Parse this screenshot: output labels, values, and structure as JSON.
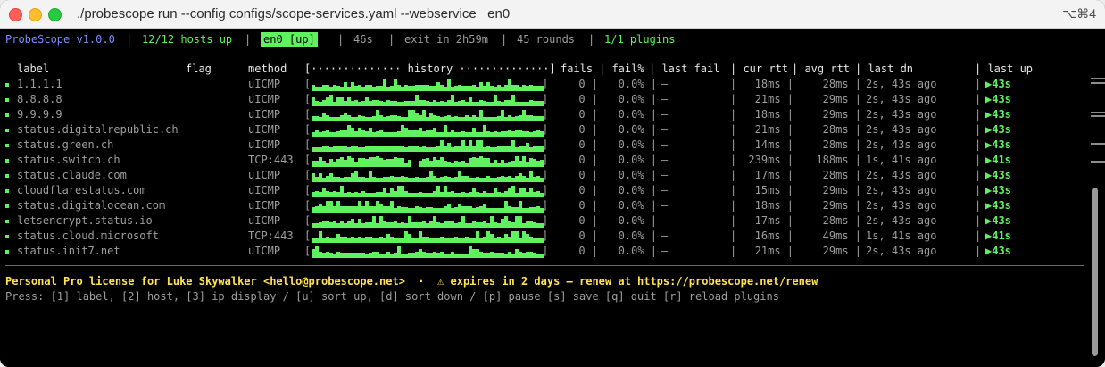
{
  "window": {
    "title": "./probescope run --config configs/scope-services.yaml --webservice   en0",
    "shortcut": "⌥⌘4"
  },
  "status": {
    "app": "ProbeScope v1.0.0",
    "hosts": "12/12 hosts up",
    "interface": "en0 [up]",
    "uptime": "46s",
    "exit": "exit in 2h59m",
    "rounds": "45 rounds",
    "plugins": "1/1 plugins",
    "sep": "|"
  },
  "table": {
    "headers": {
      "label": "label",
      "flag": "flag",
      "method": "method",
      "history": "[·············· history ··············]",
      "fails": "fails",
      "failpct": "| fail%",
      "lastfail": "| last fail",
      "currtt": "| cur rtt",
      "avgrtt": "| avg rtt",
      "lastdn": "| last dn",
      "lastup": "| last up"
    },
    "rows": [
      {
        "label": "1.1.1.1",
        "method": "uICMP",
        "fails": "0 |",
        "failpct": "0.0% |",
        "lastfail": "–",
        "currtt": "18ms |",
        "avgrtt": "28ms |",
        "lastdn": "2s, 43s ago",
        "lastup": "▶43s"
      },
      {
        "label": "8.8.8.8",
        "method": "uICMP",
        "fails": "0 |",
        "failpct": "0.0% |",
        "lastfail": "–",
        "currtt": "21ms |",
        "avgrtt": "29ms |",
        "lastdn": "2s, 43s ago",
        "lastup": "▶43s"
      },
      {
        "label": "9.9.9.9",
        "method": "uICMP",
        "fails": "0 |",
        "failpct": "0.0% |",
        "lastfail": "–",
        "currtt": "18ms |",
        "avgrtt": "29ms |",
        "lastdn": "2s, 43s ago",
        "lastup": "▶43s"
      },
      {
        "label": "status.digitalrepublic.ch",
        "method": "uICMP",
        "fails": "0 |",
        "failpct": "0.0% |",
        "lastfail": "–",
        "currtt": "21ms |",
        "avgrtt": "28ms |",
        "lastdn": "2s, 43s ago",
        "lastup": "▶43s"
      },
      {
        "label": "status.green.ch",
        "method": "uICMP",
        "fails": "0 |",
        "failpct": "0.0% |",
        "lastfail": "–",
        "currtt": "14ms |",
        "avgrtt": "28ms |",
        "lastdn": "2s, 43s ago",
        "lastup": "▶43s"
      },
      {
        "label": "status.switch.ch",
        "method": "TCP:443",
        "fails": "0 |",
        "failpct": "0.0% |",
        "lastfail": "–",
        "currtt": "239ms |",
        "avgrtt": "188ms |",
        "lastdn": "1s, 41s ago",
        "lastup": "▶41s"
      },
      {
        "label": "status.claude.com",
        "method": "uICMP",
        "fails": "0 |",
        "failpct": "0.0% |",
        "lastfail": "–",
        "currtt": "17ms |",
        "avgrtt": "28ms |",
        "lastdn": "2s, 43s ago",
        "lastup": "▶43s"
      },
      {
        "label": "cloudflarestatus.com",
        "method": "uICMP",
        "fails": "0 |",
        "failpct": "0.0% |",
        "lastfail": "–",
        "currtt": "15ms |",
        "avgrtt": "29ms |",
        "lastdn": "2s, 43s ago",
        "lastup": "▶43s"
      },
      {
        "label": "status.digitalocean.com",
        "method": "uICMP",
        "fails": "0 |",
        "failpct": "0.0% |",
        "lastfail": "–",
        "currtt": "18ms |",
        "avgrtt": "29ms |",
        "lastdn": "2s, 43s ago",
        "lastup": "▶43s"
      },
      {
        "label": "letsencrypt.status.io",
        "method": "uICMP",
        "fails": "0 |",
        "failpct": "0.0% |",
        "lastfail": "–",
        "currtt": "17ms |",
        "avgrtt": "28ms |",
        "lastdn": "2s, 43s ago",
        "lastup": "▶43s"
      },
      {
        "label": "status.cloud.microsoft",
        "method": "TCP:443",
        "fails": "0 |",
        "failpct": "0.0% |",
        "lastfail": "–",
        "currtt": "16ms |",
        "avgrtt": "49ms |",
        "lastdn": "1s, 41s ago",
        "lastup": "▶41s"
      },
      {
        "label": "status.init7.net",
        "method": "uICMP",
        "fails": "0 |",
        "failpct": "0.0% |",
        "lastfail": "–",
        "currtt": "21ms |",
        "avgrtt": "29ms |",
        "lastdn": "2s, 43s ago",
        "lastup": "▶43s"
      }
    ],
    "bracket_open": "[",
    "bracket_close": "]",
    "col_sep": "|"
  },
  "footer": {
    "license": "Personal Pro license for Luke Skywalker <hello@probescope.net>  ·  ⚠ expires in 2 days – renew at https://probescope.net/renew",
    "help": "Press: [1] label, [2] host, [3] ip display / [u] sort up, [d] sort down / [p] pause [s] save [q] quit [r] reload plugins"
  },
  "colors": {
    "accent_green": "#5ff25f",
    "app_blue": "#7d8dff",
    "license_yellow": "#ffe24d",
    "background": "#000000"
  }
}
